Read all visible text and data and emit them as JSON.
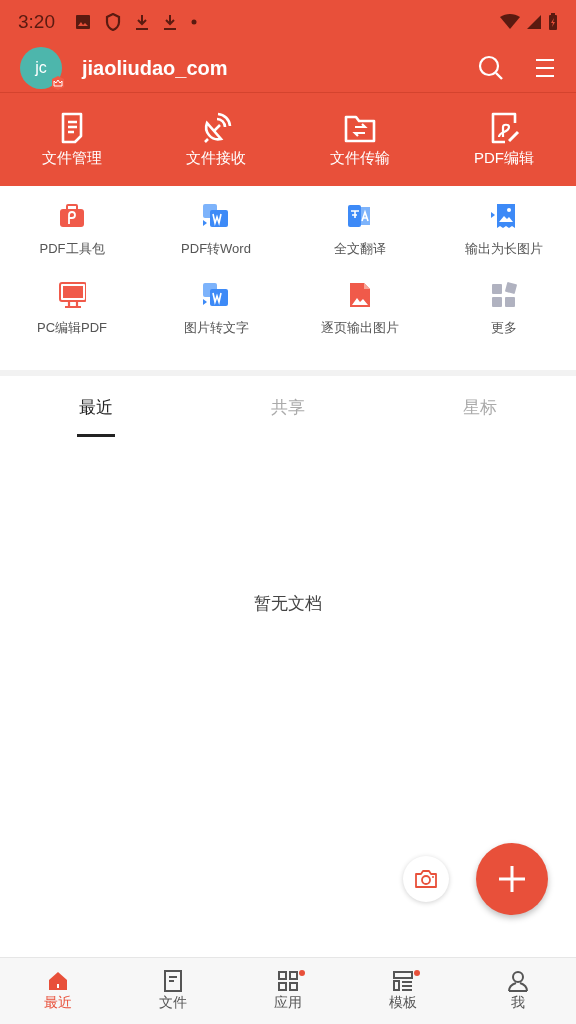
{
  "status_bar": {
    "time": "3:20"
  },
  "header": {
    "avatar_initials": "jc",
    "username": "jiaoliudao_com"
  },
  "quick_actions": [
    {
      "label": "文件管理"
    },
    {
      "label": "文件接收"
    },
    {
      "label": "文件传输"
    },
    {
      "label": "PDF编辑"
    }
  ],
  "tools": [
    {
      "label": "PDF工具包"
    },
    {
      "label": "PDF转Word"
    },
    {
      "label": "全文翻译"
    },
    {
      "label": "输出为长图片"
    },
    {
      "label": "PC编辑PDF"
    },
    {
      "label": "图片转文字"
    },
    {
      "label": "逐页输出图片"
    },
    {
      "label": "更多"
    }
  ],
  "tabs": [
    {
      "label": "最近",
      "selected": true
    },
    {
      "label": "共享",
      "selected": false
    },
    {
      "label": "星标",
      "selected": false
    }
  ],
  "empty_message": "暂无文档",
  "bottom_nav": [
    {
      "label": "最近",
      "selected": true,
      "badge": false
    },
    {
      "label": "文件",
      "selected": false,
      "badge": false
    },
    {
      "label": "应用",
      "selected": false,
      "badge": true
    },
    {
      "label": "模板",
      "selected": false,
      "badge": true
    },
    {
      "label": "我",
      "selected": false,
      "badge": false
    }
  ]
}
